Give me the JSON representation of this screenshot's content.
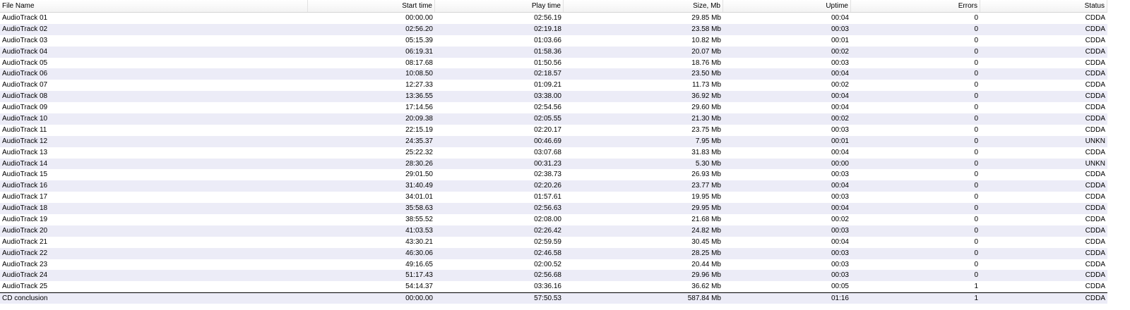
{
  "columns": {
    "file_name": "File Name",
    "start_time": "Start time",
    "play_time": "Play time",
    "size": "Size, Mb",
    "uptime": "Uptime",
    "errors": "Errors",
    "status": "Status"
  },
  "rows": [
    {
      "name": "AudioTrack 01",
      "start": "00:00.00",
      "play": "02:56.19",
      "size": "29.85 Mb",
      "uptime": "00:04",
      "errors": "0",
      "status": "CDDA"
    },
    {
      "name": "AudioTrack 02",
      "start": "02:56.20",
      "play": "02:19.18",
      "size": "23.58 Mb",
      "uptime": "00:03",
      "errors": "0",
      "status": "CDDA"
    },
    {
      "name": "AudioTrack 03",
      "start": "05:15.39",
      "play": "01:03.66",
      "size": "10.82 Mb",
      "uptime": "00:01",
      "errors": "0",
      "status": "CDDA"
    },
    {
      "name": "AudioTrack 04",
      "start": "06:19.31",
      "play": "01:58.36",
      "size": "20.07 Mb",
      "uptime": "00:02",
      "errors": "0",
      "status": "CDDA"
    },
    {
      "name": "AudioTrack 05",
      "start": "08:17.68",
      "play": "01:50.56",
      "size": "18.76 Mb",
      "uptime": "00:03",
      "errors": "0",
      "status": "CDDA"
    },
    {
      "name": "AudioTrack 06",
      "start": "10:08.50",
      "play": "02:18.57",
      "size": "23.50 Mb",
      "uptime": "00:04",
      "errors": "0",
      "status": "CDDA"
    },
    {
      "name": "AudioTrack 07",
      "start": "12:27.33",
      "play": "01:09.21",
      "size": "11.73 Mb",
      "uptime": "00:02",
      "errors": "0",
      "status": "CDDA"
    },
    {
      "name": "AudioTrack 08",
      "start": "13:36.55",
      "play": "03:38.00",
      "size": "36.92 Mb",
      "uptime": "00:04",
      "errors": "0",
      "status": "CDDA"
    },
    {
      "name": "AudioTrack 09",
      "start": "17:14.56",
      "play": "02:54.56",
      "size": "29.60 Mb",
      "uptime": "00:04",
      "errors": "0",
      "status": "CDDA"
    },
    {
      "name": "AudioTrack 10",
      "start": "20:09.38",
      "play": "02:05.55",
      "size": "21.30 Mb",
      "uptime": "00:02",
      "errors": "0",
      "status": "CDDA"
    },
    {
      "name": "AudioTrack 11",
      "start": "22:15.19",
      "play": "02:20.17",
      "size": "23.75 Mb",
      "uptime": "00:03",
      "errors": "0",
      "status": "CDDA"
    },
    {
      "name": "AudioTrack 12",
      "start": "24:35.37",
      "play": "00:46.69",
      "size": "7.95 Mb",
      "uptime": "00:01",
      "errors": "0",
      "status": "UNKN"
    },
    {
      "name": "AudioTrack 13",
      "start": "25:22.32",
      "play": "03:07.68",
      "size": "31.83 Mb",
      "uptime": "00:04",
      "errors": "0",
      "status": "CDDA"
    },
    {
      "name": "AudioTrack 14",
      "start": "28:30.26",
      "play": "00:31.23",
      "size": "5.30 Mb",
      "uptime": "00:00",
      "errors": "0",
      "status": "UNKN"
    },
    {
      "name": "AudioTrack 15",
      "start": "29:01.50",
      "play": "02:38.73",
      "size": "26.93 Mb",
      "uptime": "00:03",
      "errors": "0",
      "status": "CDDA"
    },
    {
      "name": "AudioTrack 16",
      "start": "31:40.49",
      "play": "02:20.26",
      "size": "23.77 Mb",
      "uptime": "00:04",
      "errors": "0",
      "status": "CDDA"
    },
    {
      "name": "AudioTrack 17",
      "start": "34:01.01",
      "play": "01:57.61",
      "size": "19.95 Mb",
      "uptime": "00:03",
      "errors": "0",
      "status": "CDDA"
    },
    {
      "name": "AudioTrack 18",
      "start": "35:58.63",
      "play": "02:56.63",
      "size": "29.95 Mb",
      "uptime": "00:04",
      "errors": "0",
      "status": "CDDA"
    },
    {
      "name": "AudioTrack 19",
      "start": "38:55.52",
      "play": "02:08.00",
      "size": "21.68 Mb",
      "uptime": "00:02",
      "errors": "0",
      "status": "CDDA"
    },
    {
      "name": "AudioTrack 20",
      "start": "41:03.53",
      "play": "02:26.42",
      "size": "24.82 Mb",
      "uptime": "00:03",
      "errors": "0",
      "status": "CDDA"
    },
    {
      "name": "AudioTrack 21",
      "start": "43:30.21",
      "play": "02:59.59",
      "size": "30.45 Mb",
      "uptime": "00:04",
      "errors": "0",
      "status": "CDDA"
    },
    {
      "name": "AudioTrack 22",
      "start": "46:30.06",
      "play": "02:46.58",
      "size": "28.25 Mb",
      "uptime": "00:03",
      "errors": "0",
      "status": "CDDA"
    },
    {
      "name": "AudioTrack 23",
      "start": "49:16.65",
      "play": "02:00.52",
      "size": "20.44 Mb",
      "uptime": "00:03",
      "errors": "0",
      "status": "CDDA"
    },
    {
      "name": "AudioTrack 24",
      "start": "51:17.43",
      "play": "02:56.68",
      "size": "29.96 Mb",
      "uptime": "00:03",
      "errors": "0",
      "status": "CDDA"
    },
    {
      "name": "AudioTrack 25",
      "start": "54:14.37",
      "play": "03:36.16",
      "size": "36.62 Mb",
      "uptime": "00:05",
      "errors": "1",
      "status": "CDDA"
    }
  ],
  "summary": {
    "name": "CD conclusion",
    "start": "00:00.00",
    "play": "57:50.53",
    "size": "587.84 Mb",
    "uptime": "01:16",
    "errors": "1",
    "status": "CDDA"
  }
}
